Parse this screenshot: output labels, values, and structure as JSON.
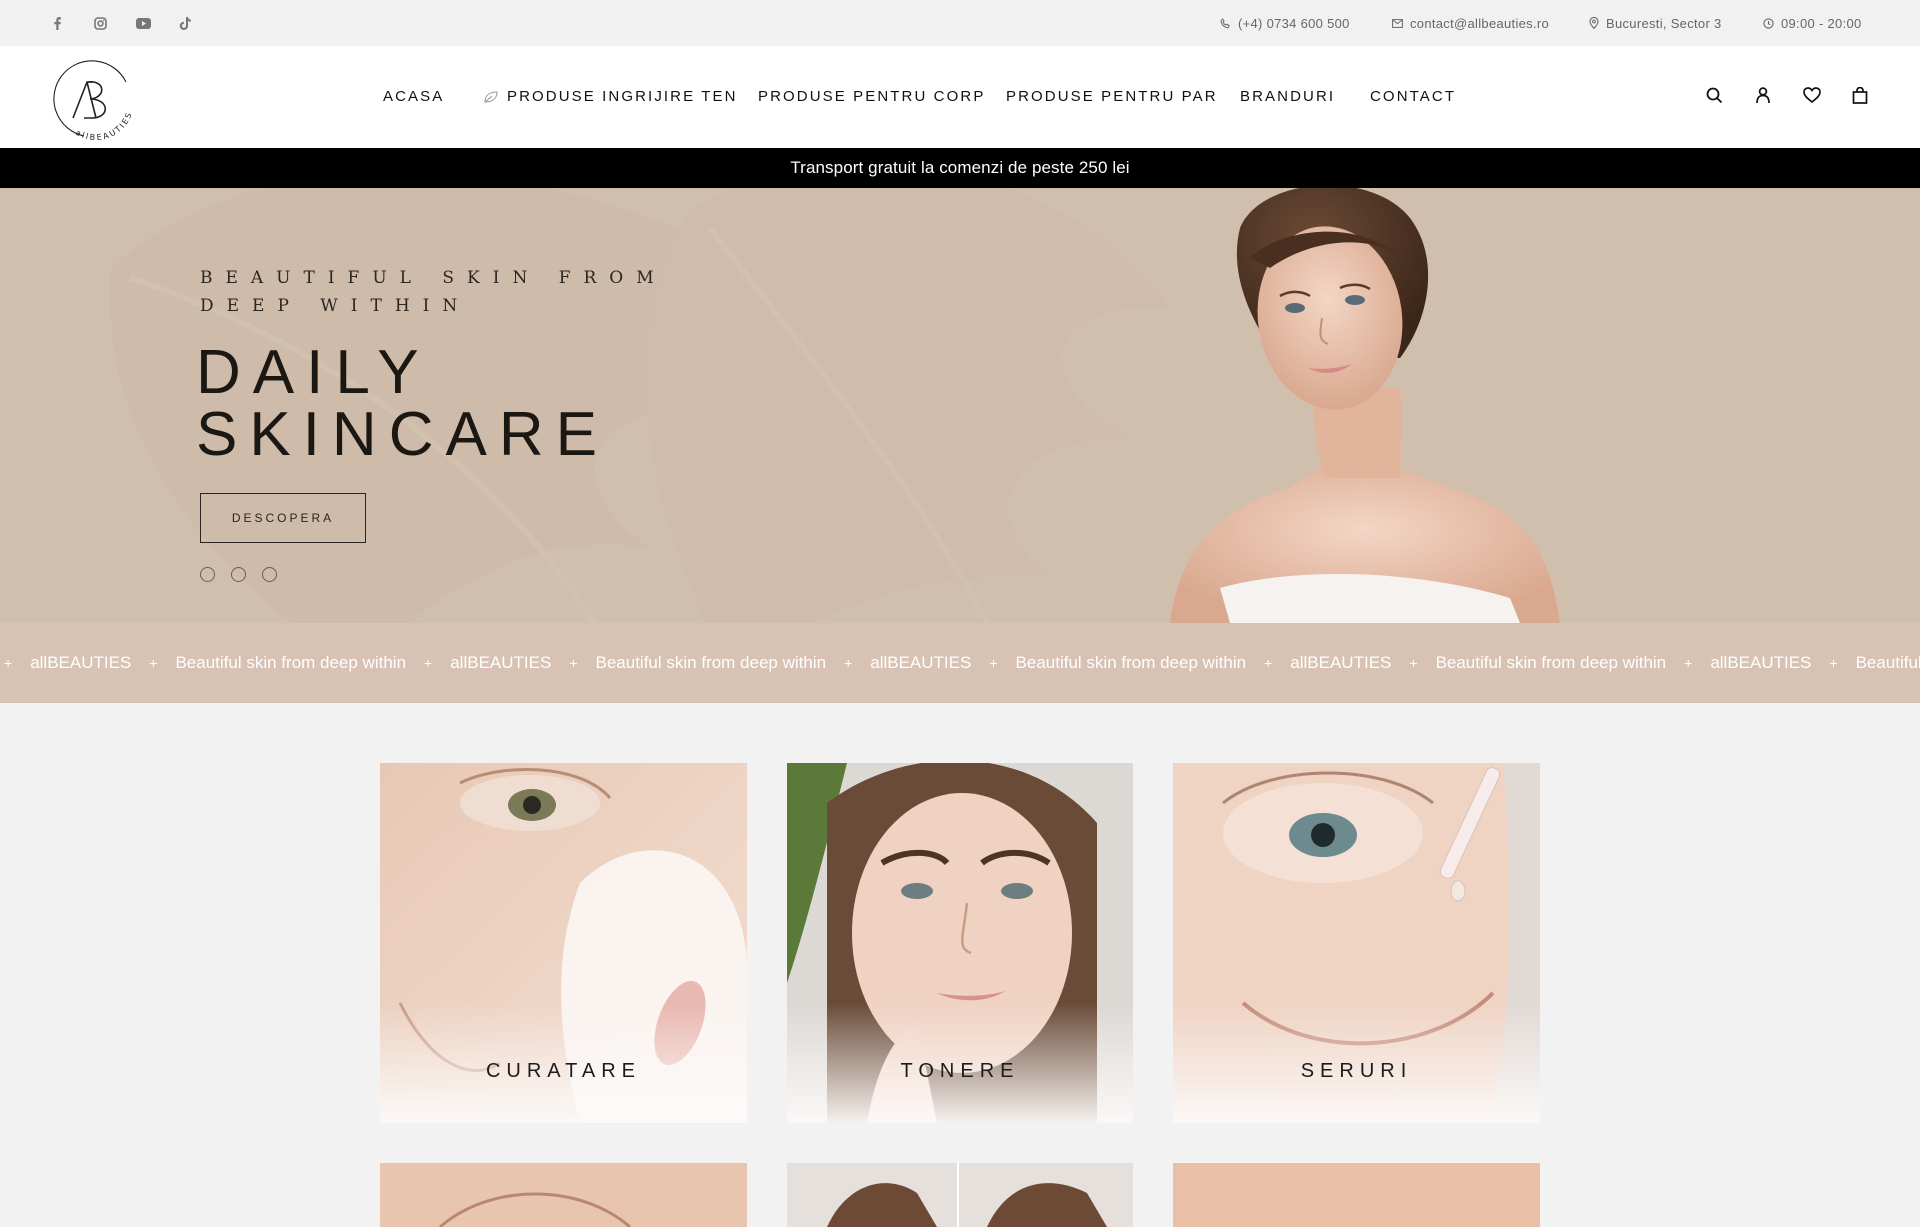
{
  "topbar": {
    "social": [
      {
        "name": "facebook-icon",
        "glyph": "f"
      },
      {
        "name": "instagram-icon",
        "glyph": ""
      },
      {
        "name": "youtube-icon",
        "glyph": ""
      },
      {
        "name": "tiktok-icon",
        "glyph": ""
      }
    ],
    "phone": "(+4) 0734 600 500",
    "email": "contact@allbeauties.ro",
    "address": "Bucuresti, Sector 3",
    "hours": "09:00 - 20:00"
  },
  "header": {
    "logo_text": "allBEAUTIES",
    "nav": [
      {
        "label": "ACASA"
      },
      {
        "label": "PRODUSE INGRIJIRE TEN"
      },
      {
        "label": "PRODUSE PENTRU CORP"
      },
      {
        "label": "PRODUSE PENTRU PAR"
      },
      {
        "label": "BRANDURI"
      },
      {
        "label": "CONTACT"
      }
    ]
  },
  "announcement": "Transport gratuit la comenzi de peste 250 lei",
  "hero": {
    "kicker": "BEAUTIFUL SKIN FROM DEEP WITHIN",
    "title_line1": "DAILY",
    "title_line2": "SKINCARE",
    "cta": "DESCOPERA",
    "slides": 3
  },
  "marquee": {
    "items": [
      "allBEAUTIES",
      "Beautiful skin from deep within",
      "allBEAUTIES",
      "Beautiful skin from deep within",
      "allBEAUTIES",
      "Beautiful skin from deep within",
      "allBEAUTIES",
      "Beautiful skin from deep within",
      "allBEAUTIES",
      "Beautiful sk"
    ]
  },
  "categories": [
    {
      "label": "CURATARE"
    },
    {
      "label": "TONERE"
    },
    {
      "label": "SERURI"
    }
  ],
  "colors": {
    "hero_bg": "#d1bfae",
    "marquee_bg": "#d7c2b3",
    "announce_bg": "#000000"
  }
}
